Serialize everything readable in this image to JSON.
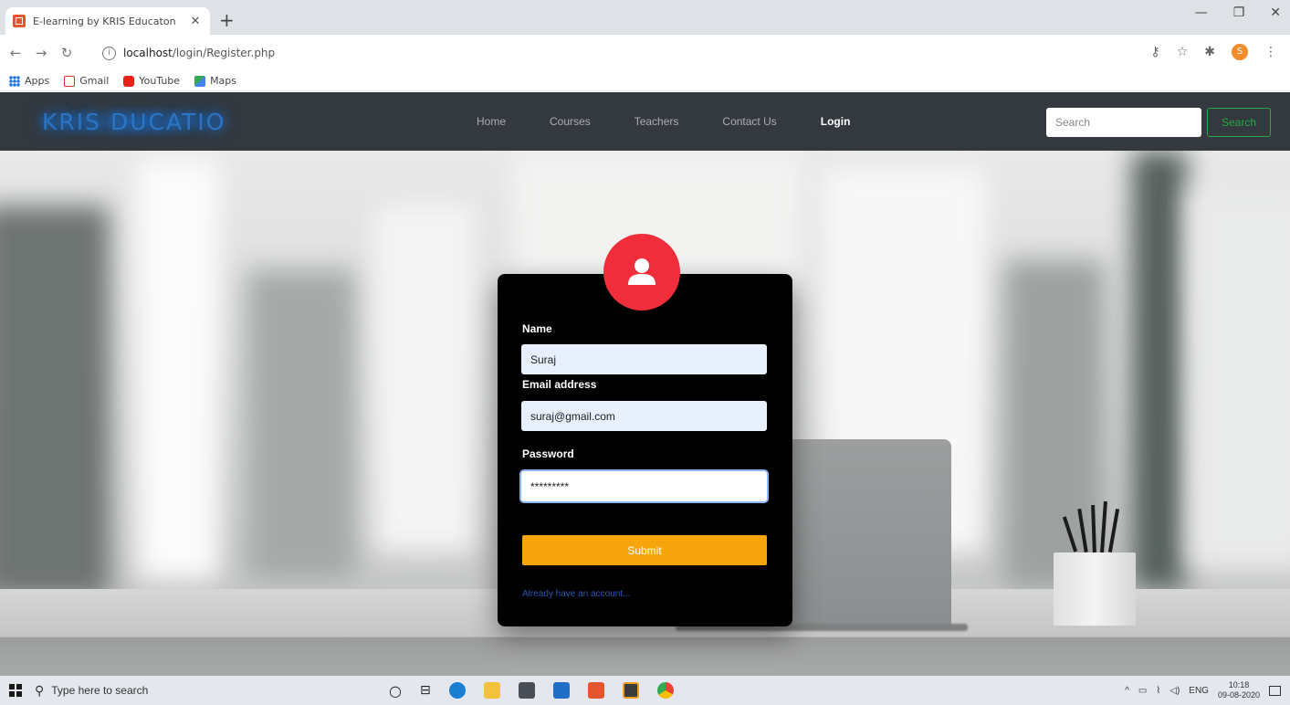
{
  "browser": {
    "tab_title": "E-learning by KRIS Educaton",
    "url_host": "localhost",
    "url_path": "/login/Register.php",
    "bookmarks": [
      {
        "label": "Apps",
        "icon": "apps-icon"
      },
      {
        "label": "Gmail",
        "icon": "gmail-icon"
      },
      {
        "label": "YouTube",
        "icon": "youtube-icon"
      },
      {
        "label": "Maps",
        "icon": "maps-icon"
      }
    ],
    "profile_initial": "S"
  },
  "site": {
    "brand": "KRIS DUCATIO",
    "nav": [
      "Home",
      "Courses",
      "Teachers",
      "Contact Us",
      "Login"
    ],
    "active_nav": "Login",
    "search_placeholder": "Search",
    "search_button": "Search"
  },
  "form": {
    "name_label": "Name",
    "name_value": "Suraj",
    "email_label": "Email address",
    "email_value": "suraj@gmail.com",
    "password_label": "Password",
    "password_value": "*********",
    "submit_label": "Submit",
    "account_link": "Already have an account..."
  },
  "taskbar": {
    "search_placeholder": "Type here to search",
    "language": "ENG",
    "time": "10:18",
    "date": "09-08-2020"
  },
  "colors": {
    "navbar_bg": "#33393f",
    "brand_glow": "#1d77d8",
    "avatar_red": "#f02d3a",
    "submit_orange": "#f7a50c",
    "search_green": "#28a745",
    "card_bg": "#000000"
  }
}
